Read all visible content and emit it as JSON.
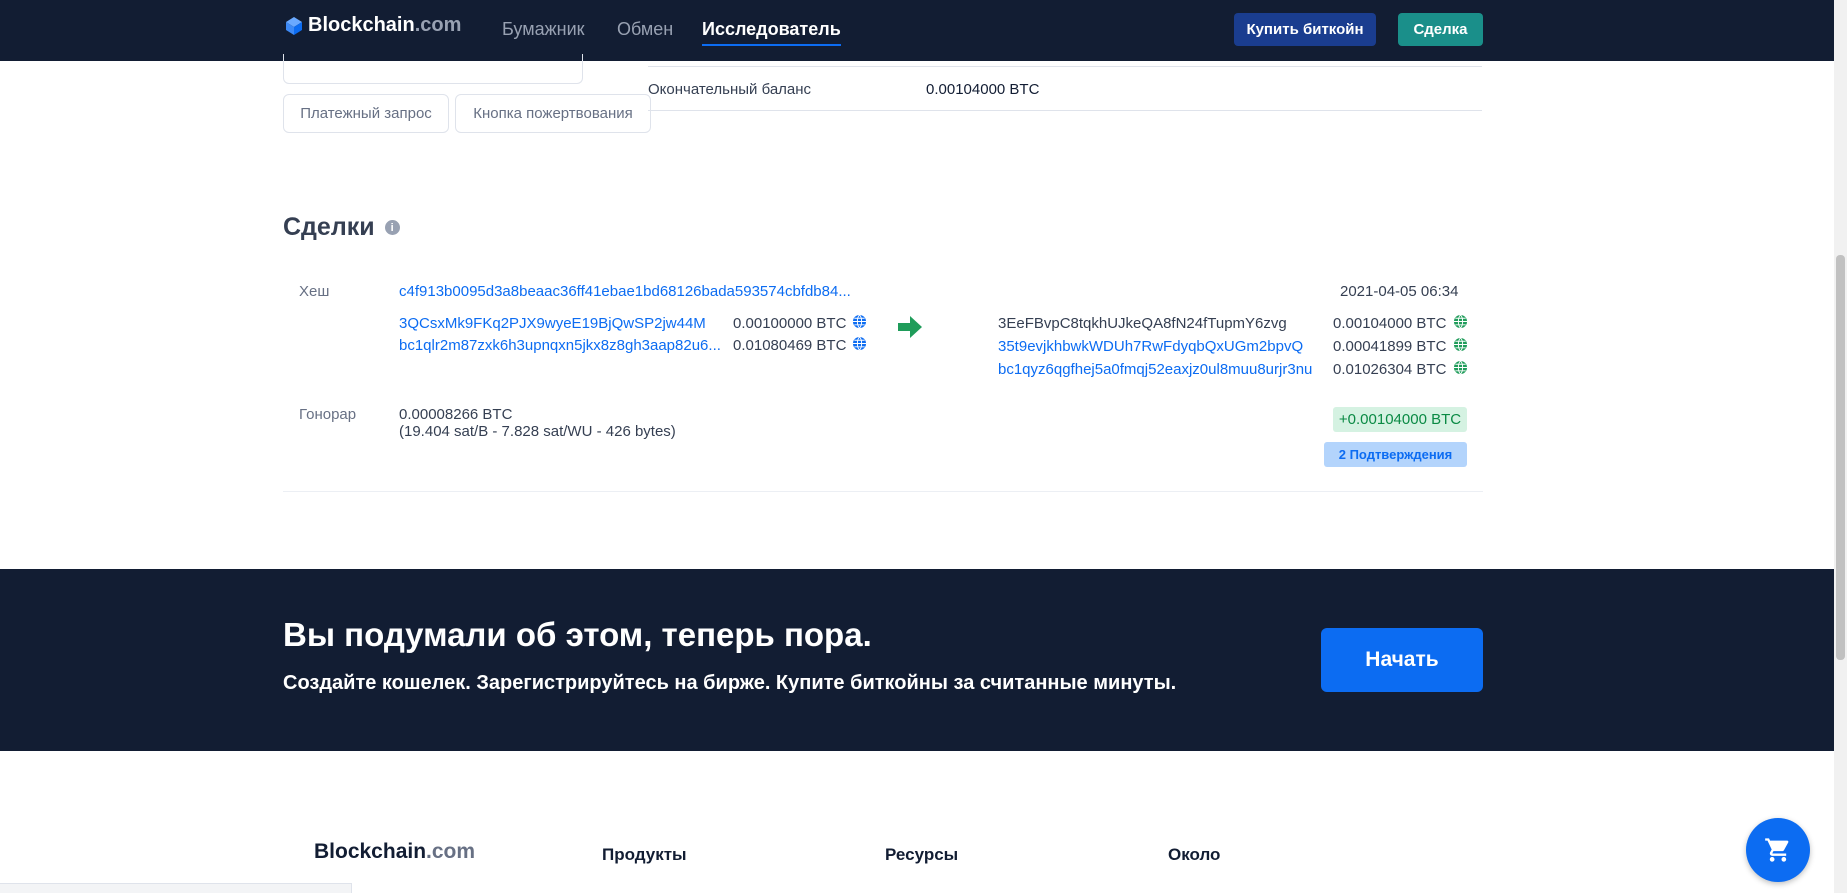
{
  "nav": {
    "brand_main": "Blockchain",
    "brand_suffix": ".com",
    "links": [
      "Бумажник",
      "Обмен",
      "Исследователь"
    ],
    "buy_button": "Купить биткойн",
    "trade_button": "Сделка"
  },
  "address_panel": {
    "payment_request": "Платежный запрос",
    "donate_button": "Кнопка пожертвования",
    "final_balance_label": "Окончательный баланс",
    "final_balance_value": "0.00104000 BTC"
  },
  "transactions": {
    "title": "Сделки",
    "hash_label": "Хеш",
    "hash": "c4f913b0095d3a8beaac36ff41ebae1bd68126bada593574cbfdb84...",
    "timestamp": "2021-04-05 06:34",
    "inputs": [
      {
        "address": "3QCsxMk9FKq2PJX9wyeE19BjQwSP2jw44M",
        "amount": "0.00100000 BTC"
      },
      {
        "address": "bc1qlr2m87zxk6h3upnqxn5jkx8z8gh3aap82u6...",
        "amount": "0.01080469 BTC"
      }
    ],
    "outputs": [
      {
        "address": "3EeFBvpC8tqkhUJkeQA8fN24fTupmY6zvg",
        "amount": "0.00104000 BTC"
      },
      {
        "address": "35t9evjkhbwkWDUh7RwFdyqbQxUGm2bpvQ",
        "amount": "0.00041899 BTC"
      },
      {
        "address": "bc1qyz6qgfhej5a0fmqj52eaxjz0ul8muu8urjr3nu",
        "amount": "0.01026304 BTC"
      }
    ],
    "fee_label": "Гонорар",
    "fee_value": "0.00008266 BTC",
    "fee_detail": "(19.404 sat/B - 7.828 sat/WU - 426 bytes)",
    "net_amount": "+0.00104000 BTC",
    "confirmations": "2 Подтверждения"
  },
  "cta": {
    "title": "Вы подумали об этом, теперь пора.",
    "subtitle": "Создайте кошелек. Зарегистрируйтесь на бирже. Купите биткойны за считанные минуты.",
    "button": "Начать"
  },
  "footer": {
    "brand_main": "Blockchain",
    "brand_suffix": ".com",
    "columns": [
      "Продукты",
      "Ресурсы",
      "Около"
    ]
  },
  "colors": {
    "navy": "#121d33",
    "blue": "#0c6cf2",
    "teal": "#1a8f8a",
    "green": "#0a8a44"
  }
}
